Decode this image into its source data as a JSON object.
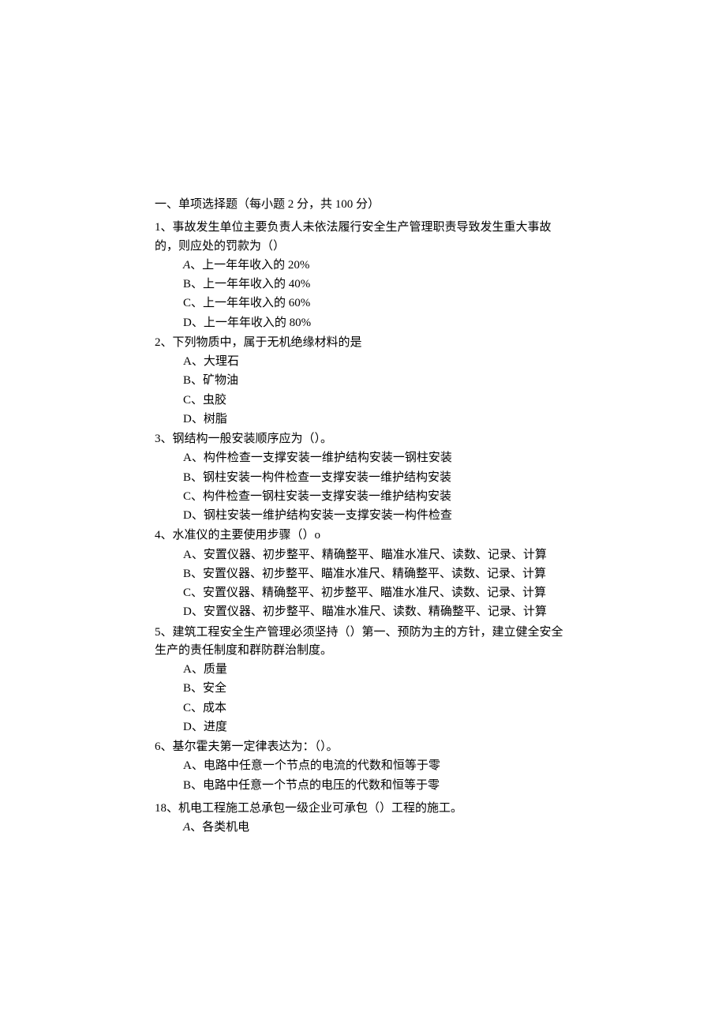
{
  "section_title": "一、单项选择题（每小题 2 分，共 100 分）",
  "questions": [
    {
      "num": "1",
      "stem": "1、事故发生单位主要负责人未依法履行安全生产管理职责导致发生重大事故的，则应处的罚款为（）",
      "options": [
        {
          "label": "A",
          "italic": true,
          "text": "、上一年年收入的 20%"
        },
        {
          "label": "B",
          "italic": false,
          "text": "、上一年年收入的 40%"
        },
        {
          "label": "C",
          "italic": false,
          "text": "、上一年年收入的 60%"
        },
        {
          "label": "D",
          "italic": false,
          "text": "、上一年年收入的 80%"
        }
      ]
    },
    {
      "num": "2",
      "stem": "2、下列物质中，属于无机绝缘材料的是",
      "options": [
        {
          "label": "A",
          "italic": false,
          "text": "、大理石"
        },
        {
          "label": "B",
          "italic": false,
          "text": "、矿物油"
        },
        {
          "label": "C",
          "italic": false,
          "text": "、虫胶"
        },
        {
          "label": "D",
          "italic": false,
          "text": "、树脂"
        }
      ]
    },
    {
      "num": "3",
      "stem": "3、钢结构一般安装顺序应为（）。",
      "options": [
        {
          "label": "A",
          "italic": false,
          "text": "、构件检查一支撑安装一维护结构安装一钢柱安装"
        },
        {
          "label": "B",
          "italic": false,
          "text": "、钢柱安装一构件检查一支撑安装一维护结构安装"
        },
        {
          "label": "C",
          "italic": false,
          "text": "、构件检查一钢柱安装一支撑安装一维护结构安装"
        },
        {
          "label": "D",
          "italic": false,
          "text": "、钢柱安装一维护结构安装一支撑安装一构件检查"
        }
      ]
    },
    {
      "num": "4",
      "stem": "4、水准仪的主要使用步骤（）o",
      "options": [
        {
          "label": "A",
          "italic": false,
          "text": "、安置仪器、初步整平、精确整平、瞄准水准尺、读数、记录、计算"
        },
        {
          "label": "B",
          "italic": false,
          "text": "、安置仪器、初步整平、瞄准水准尺、精确整平、读数、记录、计算"
        },
        {
          "label": "C",
          "italic": false,
          "text": "、安置仪器、精确整平、初步整平、瞄准水准尺、读数、记录、计算"
        },
        {
          "label": "D",
          "italic": false,
          "text": "、安置仪器、初步整平、瞄准水准尺、读数、精确整平、记录、计算"
        }
      ]
    },
    {
      "num": "5",
      "stem": "5、建筑工程安全生产管理必须坚持（）第一、预防为主的方针，建立健全安全生产的责任制度和群防群治制度。",
      "options": [
        {
          "label": "A",
          "italic": false,
          "text": "、质量"
        },
        {
          "label": "B",
          "italic": false,
          "text": "、安全"
        },
        {
          "label": "C",
          "italic": false,
          "text": "、成本"
        },
        {
          "label": "D",
          "italic": false,
          "text": "、进度"
        }
      ]
    },
    {
      "num": "6",
      "stem": "6、基尔霍夫第一定律表达为：（）。",
      "options": [
        {
          "label": "A",
          "italic": false,
          "text": "、电路中任意一个节点的电流的代数和恒等于零"
        },
        {
          "label": "B",
          "italic": false,
          "text": "、电路中任意一个节点的电压的代数和恒等于零"
        }
      ]
    },
    {
      "num": "18",
      "stem": "18、机电工程施工总承包一级企业可承包（）工程的施工。",
      "options": [
        {
          "label": "A",
          "italic": true,
          "text": "、各类机电"
        }
      ]
    }
  ]
}
